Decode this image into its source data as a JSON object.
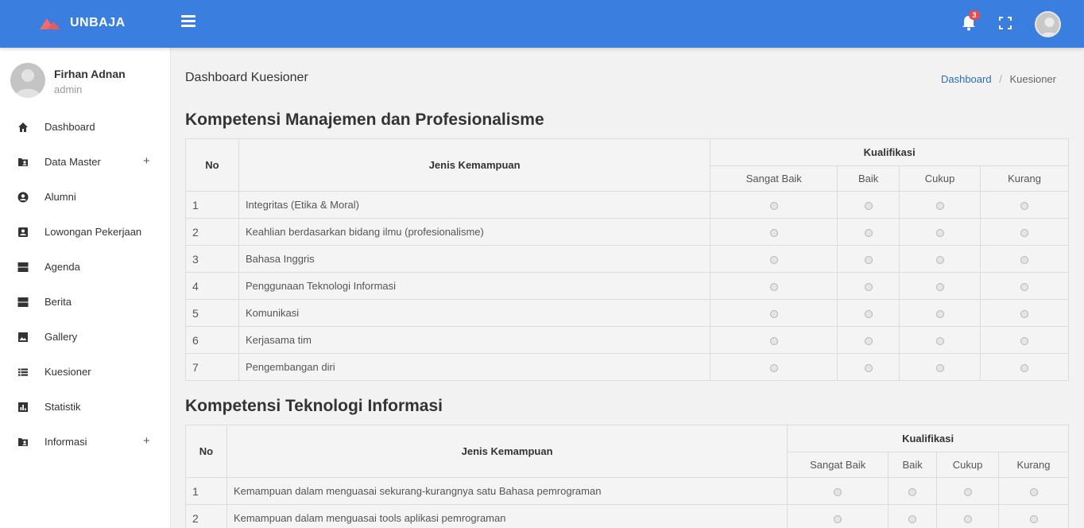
{
  "brand": {
    "name": "UNBAJA",
    "color": "#3a7fe0",
    "logo_color": "#f26b6b"
  },
  "header": {
    "notification_count": "3"
  },
  "user": {
    "name": "Firhan Adnan",
    "role": "admin"
  },
  "nav": [
    {
      "label": "Dashboard",
      "icon": "home-icon",
      "expandable": false
    },
    {
      "label": "Data Master",
      "icon": "folder-account-icon",
      "expandable": true
    },
    {
      "label": "Alumni",
      "icon": "account-circle-icon",
      "expandable": false
    },
    {
      "label": "Lowongan Pekerjaan",
      "icon": "account-box-icon",
      "expandable": false
    },
    {
      "label": "Agenda",
      "icon": "view-agenda-icon",
      "expandable": false
    },
    {
      "label": "Berita",
      "icon": "view-agenda-icon",
      "expandable": false
    },
    {
      "label": "Gallery",
      "icon": "image-icon",
      "expandable": false
    },
    {
      "label": "Kuesioner",
      "icon": "list-icon",
      "expandable": false
    },
    {
      "label": "Statistik",
      "icon": "chart-bar-icon",
      "expandable": false
    },
    {
      "label": "Informasi",
      "icon": "folder-account-icon",
      "expandable": true
    }
  ],
  "page": {
    "title": "Dashboard Kuesioner",
    "breadcrumb": {
      "home": "Dashboard",
      "current": "Kuesioner"
    }
  },
  "headers": {
    "no": "No",
    "jenis": "Jenis Kemampuan",
    "kualifikasi": "Kualifikasi",
    "levels": [
      "Sangat Baik",
      "Baik",
      "Cukup",
      "Kurang"
    ]
  },
  "sections": [
    {
      "title": "Kompetensi Manajemen dan Profesionalisme",
      "rows": [
        {
          "no": "1",
          "jenis": "Integritas (Etika & Moral)"
        },
        {
          "no": "2",
          "jenis": "Keahlian berdasarkan bidang ilmu (profesionalisme)"
        },
        {
          "no": "3",
          "jenis": "Bahasa Inggris"
        },
        {
          "no": "4",
          "jenis": "Penggunaan Teknologi Informasi"
        },
        {
          "no": "5",
          "jenis": "Komunikasi"
        },
        {
          "no": "6",
          "jenis": "Kerjasama tim"
        },
        {
          "no": "7",
          "jenis": "Pengembangan diri"
        }
      ]
    },
    {
      "title": "Kompetensi Teknologi Informasi",
      "rows": [
        {
          "no": "1",
          "jenis": "Kemampuan dalam menguasai sekurang-kurangnya satu Bahasa pemrograman"
        },
        {
          "no": "2",
          "jenis": "Kemampuan dalam menguasai tools aplikasi pemrograman"
        }
      ]
    }
  ]
}
